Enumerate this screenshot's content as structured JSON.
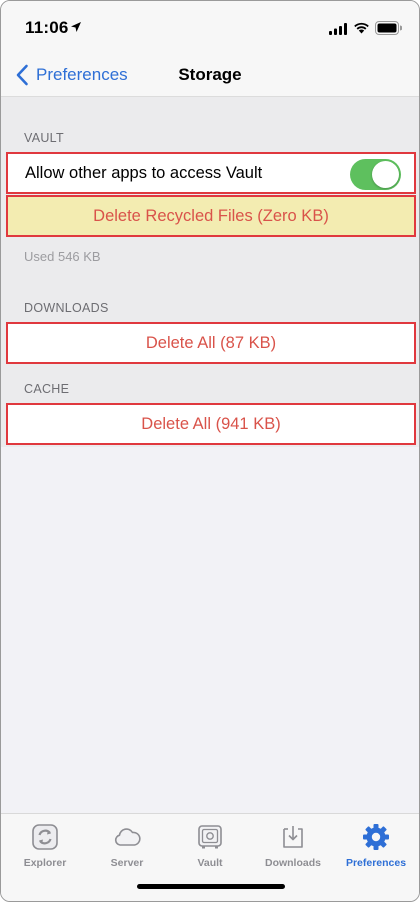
{
  "status_bar": {
    "time": "11:06"
  },
  "nav": {
    "back_label": "Preferences",
    "title": "Storage"
  },
  "vault": {
    "header": "VAULT",
    "toggle_label": "Allow other apps to access Vault",
    "toggle_on": true,
    "delete_recycled_label": "Delete Recycled Files (Zero KB)",
    "used_text": "Used 546 KB"
  },
  "downloads": {
    "header": "DOWNLOADS",
    "delete_label": "Delete All (87 KB)"
  },
  "cache": {
    "header": "CACHE",
    "delete_label": "Delete All (941 KB)"
  },
  "tabs": [
    {
      "label": "Explorer",
      "icon": "explorer-icon",
      "active": false
    },
    {
      "label": "Server",
      "icon": "cloud-icon",
      "active": false
    },
    {
      "label": "Vault",
      "icon": "vault-safe-icon",
      "active": false
    },
    {
      "label": "Downloads",
      "icon": "download-icon",
      "active": false
    },
    {
      "label": "Preferences",
      "icon": "gear-icon",
      "active": true
    }
  ],
  "colors": {
    "accent": "#2e6fd6",
    "destructive": "#d9534a",
    "toggle_on": "#5ec05e",
    "highlight_border": "#e0383e",
    "highlight_fill": "#f3ecb1"
  }
}
